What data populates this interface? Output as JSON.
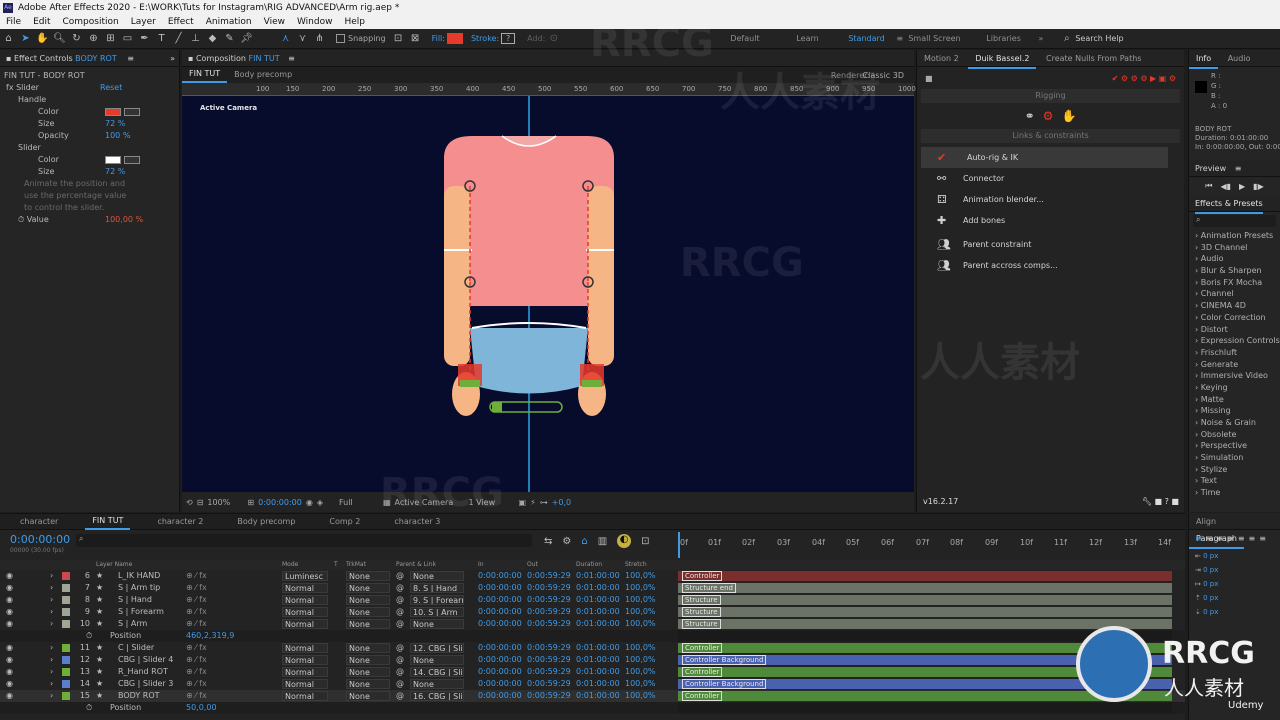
{
  "titlebar": {
    "app_icon": "Ae",
    "title": "Adobe After Effects 2020 - E:\\WORK\\Tuts for Instagram\\RIG ADVANCED\\Arm rig.aep *"
  },
  "menu": [
    "File",
    "Edit",
    "Composition",
    "Layer",
    "Effect",
    "Animation",
    "View",
    "Window",
    "Help"
  ],
  "toolbar": {
    "snapping": "Snapping",
    "fill": "Fill:",
    "stroke": "Stroke:",
    "stroke_value": "?",
    "add": "Add:",
    "workspaces": [
      "Default",
      "Learn",
      "Standard",
      "Small Screen",
      "Libraries"
    ],
    "search": "Search Help"
  },
  "colors": {
    "accent": "#3f9bea",
    "red": "#e53a2c",
    "green_label": "#6fae3b",
    "blue_label": "#5a7ec9",
    "viewer_bg": "#070b2c"
  },
  "effect_controls": {
    "tab": "Effect Controls",
    "layer": "BODY ROT",
    "breadcrumb": "FIN TUT - BODY ROT",
    "lines": [
      {
        "text": "fx  Slider",
        "value": "Reset"
      },
      {
        "text": "Handle",
        "value": ""
      },
      {
        "text": "Color",
        "value": ""
      },
      {
        "text": "Size",
        "value": "72 %"
      },
      {
        "text": "Opacity",
        "value": "100 %"
      },
      {
        "text": "Slider",
        "value": ""
      },
      {
        "text": "Color",
        "value": ""
      },
      {
        "text": "Size",
        "value": "72 %"
      },
      {
        "text": "Animate the position and",
        "value": ""
      },
      {
        "text": "use the percentage value",
        "value": ""
      },
      {
        "text": "to control the slider.",
        "value": ""
      },
      {
        "text": "Value",
        "value": "100,00 %"
      }
    ]
  },
  "composition": {
    "tab": "Composition",
    "comp_name": "FIN TUT",
    "subtabs": [
      "FIN TUT",
      "Body precomp"
    ],
    "renderer_label": "Renderer:",
    "renderer": "Classic 3D",
    "view_label": "Active Camera",
    "ruler_ticks": [
      "150",
      "100",
      "150",
      "200",
      "250",
      "300",
      "350",
      "400",
      "450",
      "500",
      "550",
      "600",
      "650",
      "700",
      "750",
      "800",
      "850",
      "900",
      "950",
      "1000",
      "1050"
    ],
    "footer": {
      "zoom": "100%",
      "timecode": "0:00:00:00",
      "quality": "Full",
      "camera": "Active Camera",
      "views": "1 View",
      "offset": "+0,0"
    }
  },
  "duik": {
    "tabs": [
      "Motion 2",
      "Duik Bassel.2",
      "Create Nulls From Paths"
    ],
    "section1": "Rigging",
    "section2": "Links & constraints",
    "items": [
      {
        "label": "Auto-rig & IK",
        "icon": "checkmark-icon"
      },
      {
        "label": "Connector",
        "icon": "connector-icon"
      },
      {
        "label": "Animation blender...",
        "icon": "blender-icon"
      },
      {
        "label": "Add bones",
        "icon": "bone-icon"
      },
      {
        "label": "Parent constraint",
        "icon": "parent-icon"
      },
      {
        "label": "Parent accross comps...",
        "icon": "parent-comps-icon"
      }
    ],
    "version": "v16.2.17"
  },
  "info": {
    "tabs": [
      "Info",
      "Audio"
    ],
    "rgba": [
      "R :",
      "G :",
      "B :",
      "A : 0"
    ],
    "layer": "BODY ROT",
    "duration": "Duration: 0:01:00:00",
    "in_out": "In: 0:00:00:00, Out: 0:00:59:29"
  },
  "preview": {
    "tab": "Preview"
  },
  "effects_presets": {
    "tab": "Effects & Presets",
    "items": [
      "Animation Presets",
      "3D Channel",
      "Audio",
      "Blur & Sharpen",
      "Boris FX Mocha",
      "Channel",
      "CINEMA 4D",
      "Color Correction",
      "Distort",
      "Expression Controls",
      "Frischluft",
      "Generate",
      "Immersive Video",
      "Keying",
      "Matte",
      "Missing",
      "Noise & Grain",
      "Obsolete",
      "Perspective",
      "Simulation",
      "Stylize",
      "Text",
      "Time"
    ]
  },
  "align": {
    "tabs": [
      "Align",
      "Paragraph"
    ],
    "px_values": [
      "0 px",
      "0 px",
      "0 px",
      "0 px",
      "0 px"
    ]
  },
  "timeline": {
    "tabs": [
      "character",
      "FIN TUT",
      "character 2",
      "Body precomp",
      "Comp 2",
      "character 3"
    ],
    "timecode": "0:00:00:00",
    "fps": "00000 (30.00 fps)",
    "columns": [
      "Layer Name",
      "Mode",
      "T",
      "TrkMat",
      "Parent & Link",
      "In",
      "Out",
      "Duration",
      "Stretch"
    ],
    "ruler": [
      "0f",
      "01f",
      "02f",
      "03f",
      "04f",
      "05f",
      "06f",
      "07f",
      "08f",
      "09f",
      "10f",
      "11f",
      "12f",
      "13f",
      "14f"
    ],
    "layers": [
      {
        "num": "6",
        "name": "L_IK HAND",
        "mode": "Luminesc",
        "trk": "None",
        "parent": "None",
        "in": "0:00:00:00",
        "out": "0:00:59:29",
        "dur": "0:01:00:00",
        "stretch": "100,0%",
        "bar": "Controller",
        "color": "#c94b4b",
        "barcolor": "#7a2e2e"
      },
      {
        "num": "7",
        "name": "S | Arm tip",
        "mode": "Normal",
        "trk": "None",
        "parent": "8. S | Hand",
        "in": "0:00:00:00",
        "out": "0:00:59:29",
        "dur": "0:01:00:00",
        "stretch": "100,0%",
        "bar": "Structure end",
        "color": "#9fa794",
        "barcolor": "#6a7366"
      },
      {
        "num": "8",
        "name": "S | Hand",
        "mode": "Normal",
        "trk": "None",
        "parent": "9. S | Forearm",
        "in": "0:00:00:00",
        "out": "0:00:59:29",
        "dur": "0:01:00:00",
        "stretch": "100,0%",
        "bar": "Structure",
        "color": "#9fa794",
        "barcolor": "#6a7366"
      },
      {
        "num": "9",
        "name": "S | Forearm",
        "mode": "Normal",
        "trk": "None",
        "parent": "10. S | Arm",
        "in": "0:00:00:00",
        "out": "0:00:59:29",
        "dur": "0:01:00:00",
        "stretch": "100,0%",
        "bar": "Structure",
        "color": "#9fa794",
        "barcolor": "#6a7366"
      },
      {
        "num": "10",
        "name": "S | Arm",
        "mode": "Normal",
        "trk": "None",
        "parent": "None",
        "in": "0:00:00:00",
        "out": "0:00:59:29",
        "dur": "0:01:00:00",
        "stretch": "100,0%",
        "bar": "Structure",
        "color": "#9fa794",
        "barcolor": "#6a7366"
      },
      {
        "num": "",
        "name": "Position",
        "mode": "",
        "trk": "",
        "parent": "",
        "in": "",
        "out": "",
        "dur": "",
        "stretch": "",
        "bar": "",
        "color": "",
        "barcolor": "",
        "value": "460,2,319,9"
      },
      {
        "num": "11",
        "name": "C | Slider",
        "mode": "Normal",
        "trk": "None",
        "parent": "12. CBG | Slid",
        "in": "0:00:00:00",
        "out": "0:00:59:29",
        "dur": "0:01:00:00",
        "stretch": "100,0%",
        "bar": "Controller",
        "color": "#6fae3b",
        "barcolor": "#4f8a3a"
      },
      {
        "num": "12",
        "name": "CBG | Slider 4",
        "mode": "Normal",
        "trk": "None",
        "parent": "None",
        "in": "0:00:00:00",
        "out": "0:00:59:29",
        "dur": "0:01:00:00",
        "stretch": "100,0%",
        "bar": "Controller Background",
        "color": "#5a7ec9",
        "barcolor": "#4a61b0"
      },
      {
        "num": "13",
        "name": "R_Hand ROT",
        "mode": "Normal",
        "trk": "None",
        "parent": "14. CBG | Slid",
        "in": "0:00:00:00",
        "out": "0:00:59:29",
        "dur": "0:01:00:00",
        "stretch": "100,0%",
        "bar": "Controller",
        "color": "#6fae3b",
        "barcolor": "#4f8a3a"
      },
      {
        "num": "14",
        "name": "CBG | Slider 3",
        "mode": "Normal",
        "trk": "None",
        "parent": "None",
        "in": "0:00:00:00",
        "out": "0:00:59:29",
        "dur": "0:01:00:00",
        "stretch": "100,0%",
        "bar": "Controller Background",
        "color": "#5a7ec9",
        "barcolor": "#4a61b0"
      },
      {
        "num": "15",
        "name": "BODY ROT",
        "mode": "Normal",
        "trk": "None",
        "parent": "16. CBG | Slid",
        "in": "0:00:00:00",
        "out": "0:00:59:29",
        "dur": "0:01:00:00",
        "stretch": "100,0%",
        "bar": "Controller",
        "color": "#6fae3b",
        "barcolor": "#4f8a3a"
      },
      {
        "num": "",
        "name": "Position",
        "mode": "",
        "trk": "",
        "parent": "",
        "in": "",
        "out": "",
        "dur": "",
        "stretch": "",
        "bar": "",
        "color": "",
        "barcolor": "",
        "value": "50,0,00"
      }
    ]
  },
  "watermarks": [
    "RRCG",
    "人人素材",
    "RRCG",
    "人人素材",
    "RRCG"
  ],
  "branding": {
    "rrcg": "RRCG",
    "sub": "人人素材",
    "udemy": "Udemy"
  }
}
